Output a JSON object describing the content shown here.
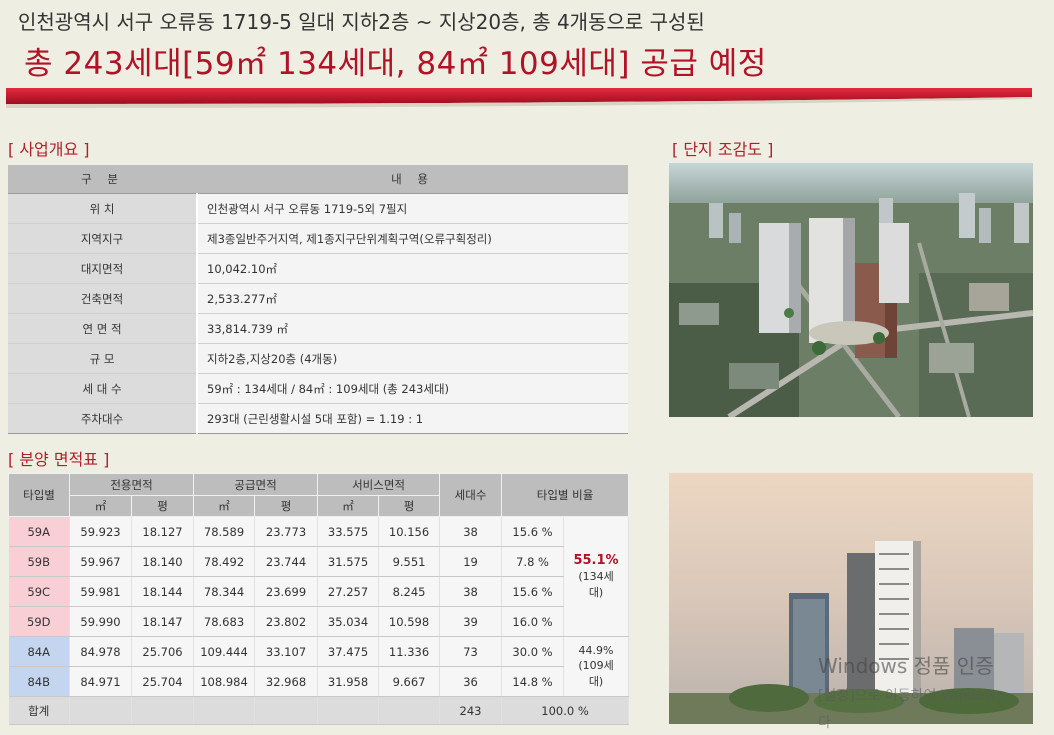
{
  "header": {
    "subtitle": "인천광역시 서구 오류동 1719-5 일대 지하2층 ~ 지상20층, 총 4개동으로 구성된",
    "title": "총 243세대[59㎡ 134세대, 84㎡ 109세대] 공급 예정"
  },
  "colors": {
    "accent": "#b01226",
    "banner": "#c8102e",
    "type59": "#f9cfd6",
    "type84": "#c4d6ef"
  },
  "overview": {
    "section_title": "[ 사업개요 ]",
    "col_label": "구 분",
    "col_value": "내 용",
    "rows": [
      {
        "label": "위     치",
        "value": "인천광역시 서구 오류동 1719-5외 7필지"
      },
      {
        "label": "지역지구",
        "value": "제3종일반주거지역, 제1종지구단위계획구역(오류구획정리)"
      },
      {
        "label": "대지면적",
        "value": "10,042.10㎡"
      },
      {
        "label": "건축면적",
        "value": "2,533.277㎡"
      },
      {
        "label": "연 면 적",
        "value": "33,814.739 ㎡"
      },
      {
        "label": "규     모",
        "value": "지하2층,지상20층 (4개동)"
      },
      {
        "label": "세 대 수",
        "value": "59㎡ : 134세대 / 84㎡ : 109세대 (총 243세대)"
      },
      {
        "label": "주차대수",
        "value": "293대 (근린생활시설 5대 포함) = 1.19 : 1"
      }
    ]
  },
  "area_table": {
    "section_title": "[ 분양 면적표 ]",
    "headers": {
      "type": "타입별",
      "exclusive": "전용면적",
      "supply": "공급면적",
      "service": "서비스면적",
      "units": "세대수",
      "ratio": "타입별 비율",
      "sqm": "㎡",
      "pyeong": "평"
    },
    "rows": [
      {
        "type": "59A",
        "ex_m2": "59.923",
        "ex_py": "18.127",
        "su_m2": "78.589",
        "su_py": "23.773",
        "sv_m2": "33.575",
        "sv_py": "10.156",
        "units": "38",
        "ratio": "15.6 %"
      },
      {
        "type": "59B",
        "ex_m2": "59.967",
        "ex_py": "18.140",
        "su_m2": "78.492",
        "su_py": "23.744",
        "sv_m2": "31.575",
        "sv_py": "9.551",
        "units": "19",
        "ratio": "7.8 %"
      },
      {
        "type": "59C",
        "ex_m2": "59.981",
        "ex_py": "18.144",
        "su_m2": "78.344",
        "su_py": "23.699",
        "sv_m2": "27.257",
        "sv_py": "8.245",
        "units": "38",
        "ratio": "15.6 %"
      },
      {
        "type": "59D",
        "ex_m2": "59.990",
        "ex_py": "18.147",
        "su_m2": "78.683",
        "su_py": "23.802",
        "sv_m2": "35.034",
        "sv_py": "10.598",
        "units": "39",
        "ratio": "16.0 %"
      },
      {
        "type": "84A",
        "ex_m2": "84.978",
        "ex_py": "25.706",
        "su_m2": "109.444",
        "su_py": "33.107",
        "sv_m2": "37.475",
        "sv_py": "11.336",
        "units": "73",
        "ratio": "30.0 %"
      },
      {
        "type": "84B",
        "ex_m2": "84.971",
        "ex_py": "25.704",
        "su_m2": "108.984",
        "su_py": "32.968",
        "sv_m2": "31.958",
        "sv_py": "9.667",
        "units": "36",
        "ratio": "14.8 %"
      }
    ],
    "group59": {
      "pct": "55.1%",
      "note1": "(134세",
      "note2": "대)"
    },
    "group84": {
      "pct": "44.9%",
      "note1": "(109세",
      "note2": "대)"
    },
    "total": {
      "label": "합계",
      "units": "243",
      "ratio": "100.0 %"
    }
  },
  "aerial": {
    "section_title": "[ 단지 조감도 ]"
  },
  "watermark": {
    "line1": "Windows 정품 인증",
    "line2": "[설정]으로 이동하여 Windows",
    "line3": "다"
  }
}
